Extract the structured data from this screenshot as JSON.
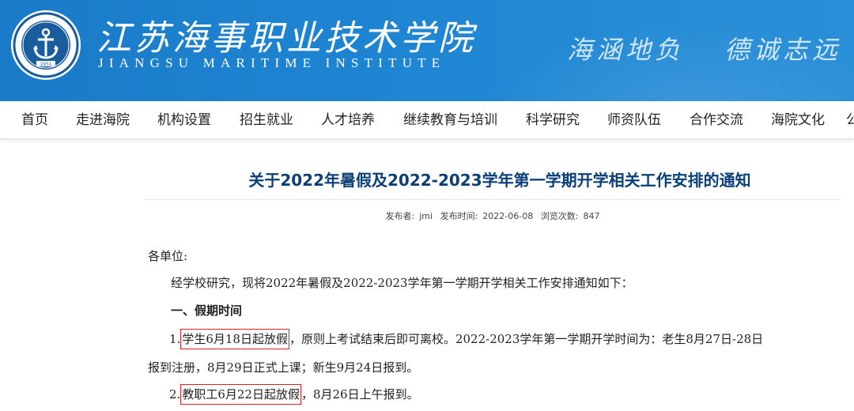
{
  "header": {
    "school_name_cn": "江苏海事职业技术学院",
    "school_name_en": "JIANGSU MARITIME INSTITUTE",
    "logo_year": "1951",
    "motto_part1": "海涵地负",
    "motto_part2": "德诚志远",
    "banner_color": "#1f86d3"
  },
  "nav": {
    "items": [
      "首页",
      "走进海院",
      "机构设置",
      "招生就业",
      "人才培养",
      "继续教育与培训",
      "科学研究",
      "师资队伍",
      "合作交流",
      "海院文化",
      "公"
    ]
  },
  "article": {
    "title": "关于2022年暑假及2022-2023学年第一学期开学相关工作安排的通知",
    "title_color": "#0b3f78",
    "meta": {
      "publisher_label": "发布者:",
      "publisher": "jmi",
      "date_label": "发布时间:",
      "date": "2022-06-08",
      "views_label": "浏览次数:",
      "views": "847"
    },
    "salutation": "各单位:",
    "intro": "经学校研究，现将2022年暑假及2022-2023学年第一学期开学相关工作安排通知如下：",
    "section1_heading": "一、假期时间",
    "item1": {
      "number": "1.",
      "highlight": "学生6月18日起放假",
      "rest": "，原则上考试结束后即可离校。2022-2023学年第一学期开学时间为：老生8月27日-28日",
      "continuation": "报到注册，8月29日正式上课；新生9月24日报到。"
    },
    "item2": {
      "number": "2.",
      "highlight": "教职工6月22日起放假",
      "rest": "，8月26日上午报到。"
    },
    "highlight_border_color": "#e02020"
  }
}
